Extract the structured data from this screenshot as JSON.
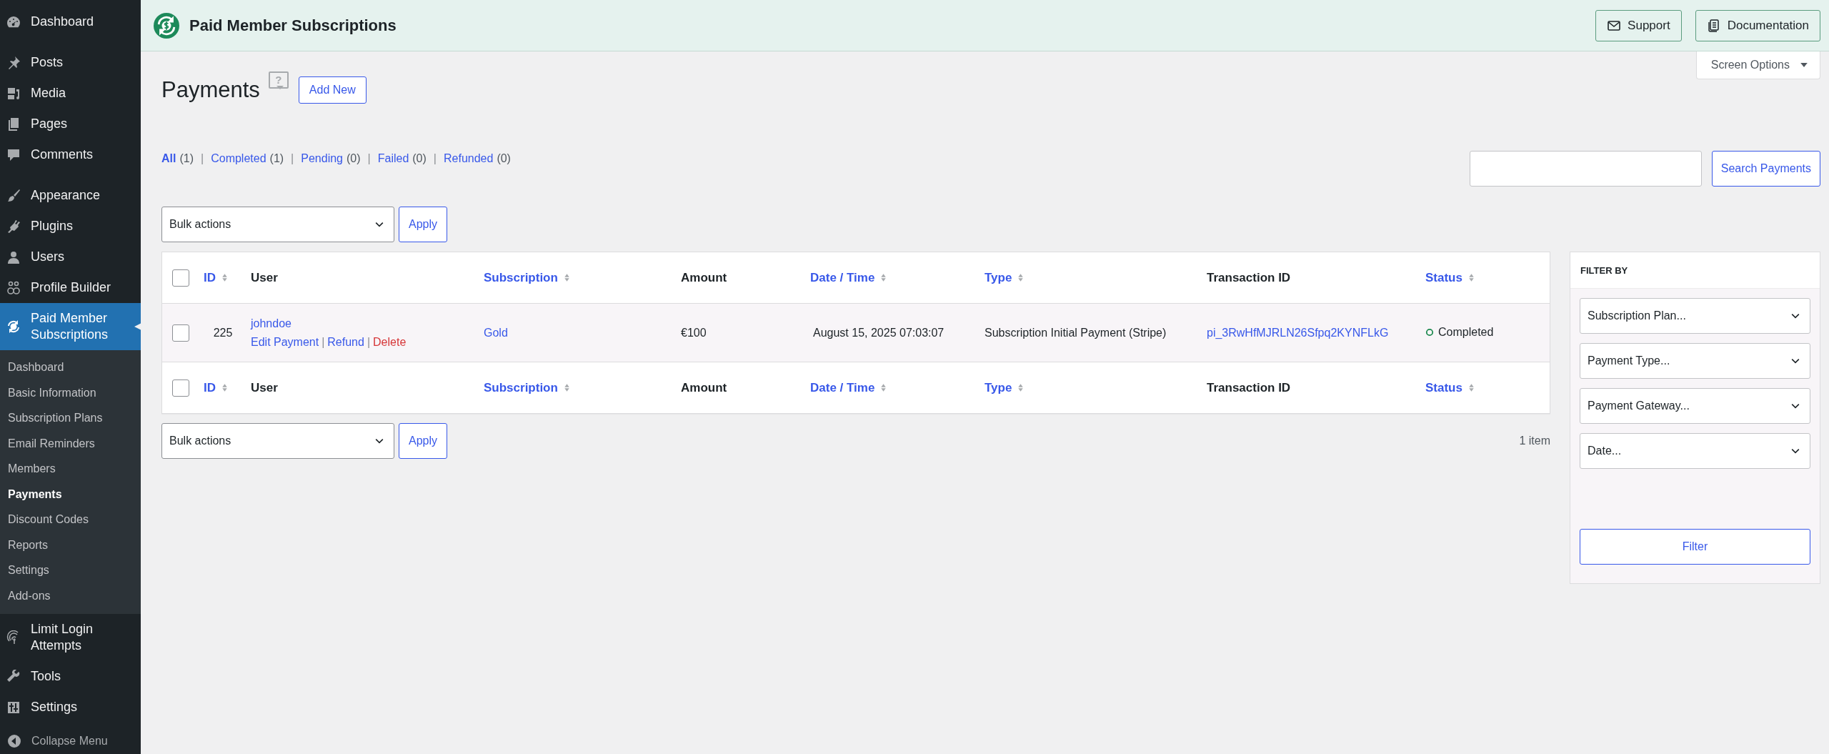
{
  "sidebar": {
    "groups": [
      [
        {
          "label": "Dashboard",
          "selected": false
        }
      ],
      [
        {
          "label": "Posts",
          "selected": false
        },
        {
          "label": "Media",
          "selected": false
        },
        {
          "label": "Pages",
          "selected": false
        },
        {
          "label": "Comments",
          "selected": false
        }
      ],
      [
        {
          "label": "Appearance",
          "selected": false
        },
        {
          "label": "Plugins",
          "selected": false
        },
        {
          "label": "Users",
          "selected": false
        },
        {
          "label": "Profile Builder",
          "selected": false
        },
        {
          "label": "Paid Member Subscriptions",
          "selected": true,
          "expanded": true,
          "children": [
            {
              "label": "Dashboard",
              "selected": false
            },
            {
              "label": "Basic Information",
              "selected": false
            },
            {
              "label": "Subscription Plans",
              "selected": false
            },
            {
              "label": "Email Reminders",
              "selected": false
            },
            {
              "label": "Members",
              "selected": false
            },
            {
              "label": "Payments",
              "selected": true
            },
            {
              "label": "Discount Codes",
              "selected": false
            },
            {
              "label": "Reports",
              "selected": false
            },
            {
              "label": "Settings",
              "selected": false
            },
            {
              "label": "Add-ons",
              "selected": false
            }
          ]
        },
        {
          "label": "Limit Login Attempts",
          "selected": false
        },
        {
          "label": "Tools",
          "selected": false
        },
        {
          "label": "Settings",
          "selected": false
        }
      ]
    ],
    "collapse": "Collapse Menu"
  },
  "header": {
    "title": "Paid Member Subscriptions",
    "buttons": [
      "Support",
      "Documentation"
    ]
  },
  "screen_options": {
    "label": "Screen Options",
    "expanded": false
  },
  "page": {
    "title": "Payments",
    "help": "?",
    "add_new": "Add New"
  },
  "views": [
    {
      "label": "All",
      "count": "(1)",
      "selected": true
    },
    {
      "separator": "|",
      "label": "Completed",
      "count": "(1)",
      "selected": false
    },
    {
      "separator": "|",
      "label": "Pending",
      "count": "(0)",
      "selected": false
    },
    {
      "separator": "|",
      "label": "Failed",
      "count": "(0)",
      "selected": false
    },
    {
      "separator": "|",
      "label": "Refunded",
      "count": "(0)",
      "selected": false
    }
  ],
  "search": {
    "button": "Search Payments"
  },
  "bulk_top": {
    "value": "Bulk actions",
    "apply": "Apply"
  },
  "table": {
    "header_row": {
      "checked": false,
      "columns": [
        {
          "label": "ID",
          "sortable": true
        },
        {
          "label": "User",
          "sortable": false
        },
        {
          "label": "Subscription",
          "sortable": true
        },
        {
          "label": "Amount",
          "sortable": false
        },
        {
          "label": "Date / Time",
          "sortable": true
        },
        {
          "label": "Type",
          "sortable": true
        },
        {
          "label": "Transaction ID",
          "sortable": false
        },
        {
          "label": "Status",
          "sortable": true
        }
      ]
    },
    "rows": [
      {
        "checked": false,
        "id": "225",
        "user": "johndoe",
        "actions": [
          {
            "label": "Edit Payment",
            "kind": "link"
          },
          {
            "separator": "|",
            "label": "Refund",
            "kind": "link"
          },
          {
            "separator": "|",
            "label": "Delete",
            "kind": "danger"
          }
        ],
        "subscription": "Gold",
        "amount": "€100",
        "date": "August 15, 2025 07:03:07",
        "type": "Subscription Initial Payment (Stripe)",
        "transaction_id": "pi_3RwHfMJRLN26Sfpq2KYNFLkG",
        "status": "Completed"
      }
    ],
    "footer_row": {
      "checked": false,
      "columns": [
        {
          "label": "ID",
          "sortable": true
        },
        {
          "label": "User",
          "sortable": false
        },
        {
          "label": "Subscription",
          "sortable": true
        },
        {
          "label": "Amount",
          "sortable": false
        },
        {
          "label": "Date / Time",
          "sortable": true
        },
        {
          "label": "Type",
          "sortable": true
        },
        {
          "label": "Transaction ID",
          "sortable": false
        },
        {
          "label": "Status",
          "sortable": true
        }
      ]
    }
  },
  "bulk_bottom": {
    "value": "Bulk actions",
    "apply": "Apply"
  },
  "item_count": "1 item",
  "filter_panel": {
    "title": "FILTER BY",
    "selects": [
      "Subscription Plan...",
      "Payment Type...",
      "Payment Gateway...",
      "Date..."
    ],
    "button": "Filter"
  }
}
